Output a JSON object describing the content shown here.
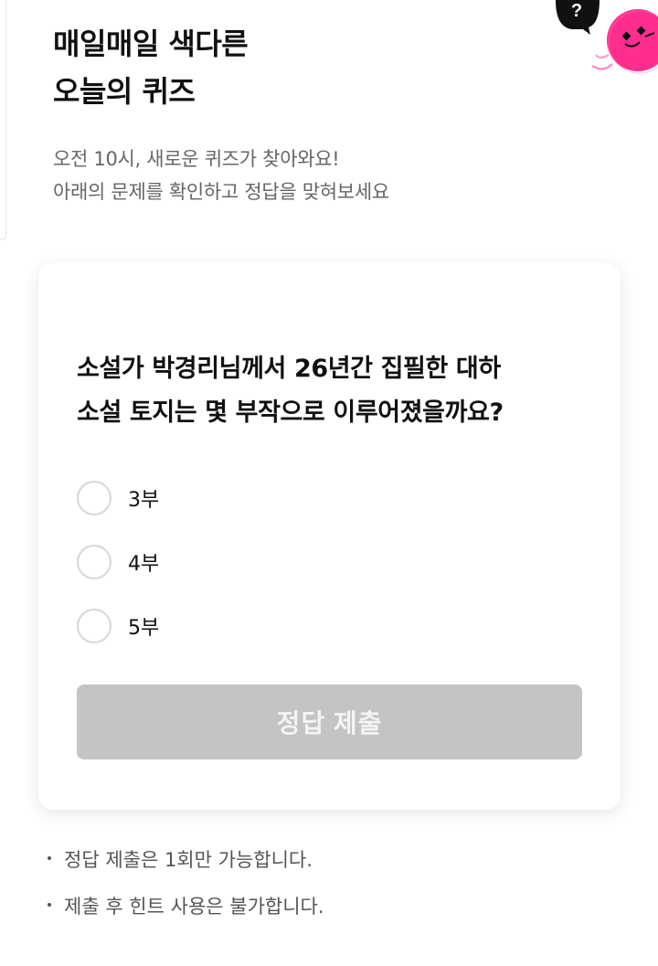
{
  "header": {
    "title_line1": "매일매일 색다른",
    "title_line2": "오늘의 퀴즈",
    "subtitle_line1": "오전 10시, 새로운 퀴즈가 찾아와요!",
    "subtitle_line2": "아래의 문제를 확인하고 정답을 맞혀보세요"
  },
  "icons": {
    "help_icon": "question-bubble-icon",
    "mascot_icon": "pink-mascot-icon"
  },
  "quiz": {
    "question_line1": "소설가 박경리님께서 26년간 집필한 대하",
    "question_line2": "소설 토지는 몇 부작으로 이루어졌을까요?",
    "options": [
      {
        "label": "3부"
      },
      {
        "label": "4부"
      },
      {
        "label": "5부"
      }
    ],
    "submit_label": "정답 제출"
  },
  "notes": [
    {
      "text": "정답 제출은 1회만 가능합니다."
    },
    {
      "text": "제출 후 힌트 사용은 불가합니다."
    }
  ],
  "colors": {
    "accent_pink": "#ff2e8e",
    "submit_disabled": "#c4c4c4",
    "text_muted": "#666666"
  }
}
